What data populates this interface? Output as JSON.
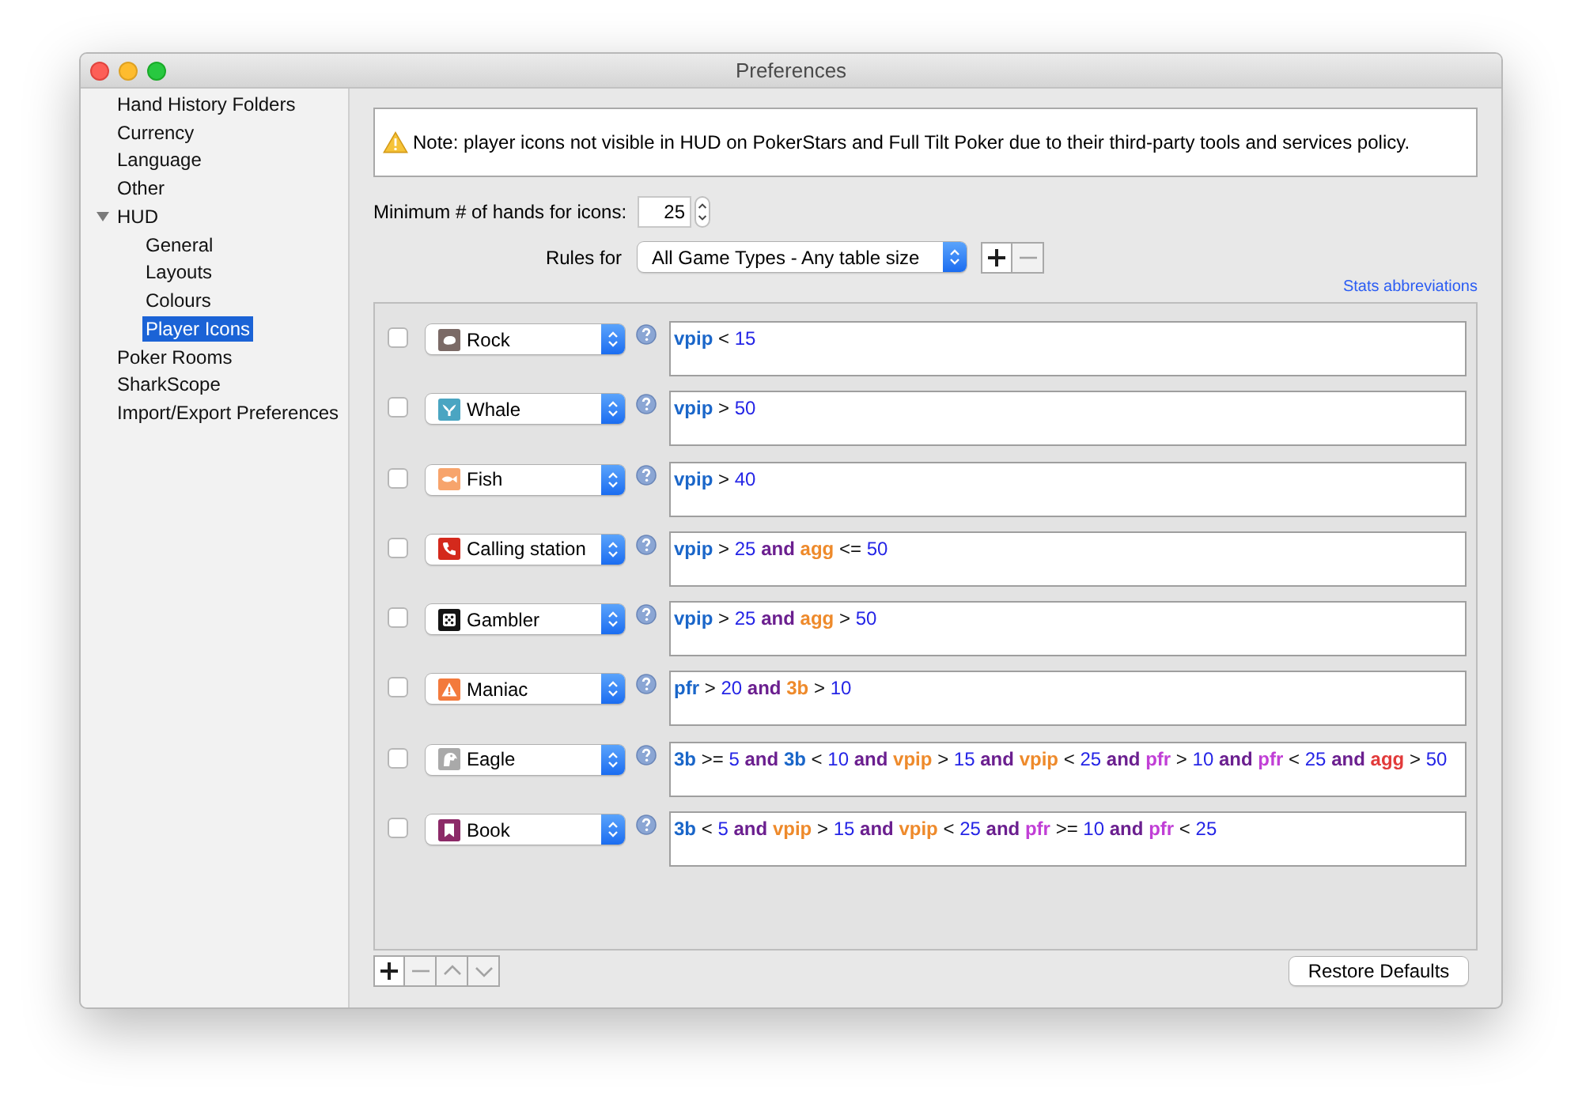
{
  "window": {
    "title": "Preferences"
  },
  "sidebar": {
    "items": [
      {
        "label": "Hand History Folders",
        "selected": false
      },
      {
        "label": "Currency",
        "selected": false
      },
      {
        "label": "Language",
        "selected": false
      },
      {
        "label": "Other",
        "selected": false
      },
      {
        "label": "HUD",
        "selected": false,
        "expanded": true,
        "children": [
          {
            "label": "General",
            "selected": false
          },
          {
            "label": "Layouts",
            "selected": false
          },
          {
            "label": "Colours",
            "selected": false
          },
          {
            "label": "Player Icons",
            "selected": true
          }
        ]
      },
      {
        "label": "Poker Rooms",
        "selected": false
      },
      {
        "label": "SharkScope",
        "selected": false
      },
      {
        "label": "Import/Export Preferences",
        "selected": false
      }
    ]
  },
  "note": {
    "text": "Note: player icons not visible in HUD on PokerStars and Full Tilt Poker due to their third-party tools and services policy."
  },
  "min_hands": {
    "label": "Minimum # of hands for icons:",
    "value": "25"
  },
  "rules_for": {
    "label": "Rules for",
    "value": "All Game Types - Any table size",
    "buttons": [
      {
        "kind": "add",
        "disabled": false
      },
      {
        "kind": "remove",
        "disabled": true
      }
    ]
  },
  "stats_link": "Stats abbreviations",
  "rules": [
    {
      "checked": false,
      "icon": {
        "kind": "rock",
        "color": "#7b6a66"
      },
      "type": "Rock",
      "condition": [
        {
          "kind": "stat",
          "text": "vpip",
          "color": "#1a66c9"
        },
        {
          "kind": "operator",
          "text": "<"
        },
        {
          "kind": "number",
          "text": "15"
        }
      ]
    },
    {
      "checked": false,
      "icon": {
        "kind": "whale",
        "color": "#4aa5c2"
      },
      "type": "Whale",
      "condition": [
        {
          "kind": "stat",
          "text": "vpip",
          "color": "#1a66c9"
        },
        {
          "kind": "operator",
          "text": ">"
        },
        {
          "kind": "number",
          "text": "50"
        }
      ]
    },
    {
      "checked": false,
      "icon": {
        "kind": "fish",
        "color": "#f7a46c"
      },
      "type": "Fish",
      "condition": [
        {
          "kind": "stat",
          "text": "vpip",
          "color": "#1a66c9"
        },
        {
          "kind": "operator",
          "text": ">"
        },
        {
          "kind": "number",
          "text": "40"
        }
      ]
    },
    {
      "checked": false,
      "icon": {
        "kind": "phone",
        "color": "#d4291c"
      },
      "type": "Calling station",
      "condition": [
        {
          "kind": "stat",
          "text": "vpip",
          "color": "#1a66c9"
        },
        {
          "kind": "operator",
          "text": ">"
        },
        {
          "kind": "number",
          "text": "25"
        },
        {
          "kind": "keyword",
          "text": "and"
        },
        {
          "kind": "stat",
          "text": "agg",
          "color": "#ee8a2b"
        },
        {
          "kind": "operator",
          "text": "<="
        },
        {
          "kind": "number",
          "text": "50"
        }
      ]
    },
    {
      "checked": false,
      "icon": {
        "kind": "dice",
        "color": "#151515"
      },
      "type": "Gambler",
      "condition": [
        {
          "kind": "stat",
          "text": "vpip",
          "color": "#1a66c9"
        },
        {
          "kind": "operator",
          "text": ">"
        },
        {
          "kind": "number",
          "text": "25"
        },
        {
          "kind": "keyword",
          "text": "and"
        },
        {
          "kind": "stat",
          "text": "agg",
          "color": "#ee8a2b"
        },
        {
          "kind": "operator",
          "text": ">"
        },
        {
          "kind": "number",
          "text": "50"
        }
      ]
    },
    {
      "checked": false,
      "icon": {
        "kind": "warning",
        "color": "#f37a3c"
      },
      "type": "Maniac",
      "condition": [
        {
          "kind": "stat",
          "text": "pfr",
          "color": "#1a66c9"
        },
        {
          "kind": "operator",
          "text": ">"
        },
        {
          "kind": "number",
          "text": "20"
        },
        {
          "kind": "keyword",
          "text": "and"
        },
        {
          "kind": "stat",
          "text": "3b",
          "color": "#ee8a2b"
        },
        {
          "kind": "operator",
          "text": ">"
        },
        {
          "kind": "number",
          "text": "10"
        }
      ]
    },
    {
      "checked": false,
      "icon": {
        "kind": "bird",
        "color": "#a9a9a9"
      },
      "type": "Eagle",
      "condition": [
        {
          "kind": "stat",
          "text": "3b",
          "color": "#1a66c9"
        },
        {
          "kind": "operator",
          "text": ">="
        },
        {
          "kind": "number",
          "text": "5"
        },
        {
          "kind": "keyword",
          "text": "and"
        },
        {
          "kind": "stat",
          "text": "3b",
          "color": "#1a66c9"
        },
        {
          "kind": "operator",
          "text": "<"
        },
        {
          "kind": "number",
          "text": "10"
        },
        {
          "kind": "keyword",
          "text": "and"
        },
        {
          "kind": "stat",
          "text": "vpip",
          "color": "#ee8a2b"
        },
        {
          "kind": "operator",
          "text": ">"
        },
        {
          "kind": "number",
          "text": "15"
        },
        {
          "kind": "keyword",
          "text": "and"
        },
        {
          "kind": "stat",
          "text": "vpip",
          "color": "#ee8a2b"
        },
        {
          "kind": "operator",
          "text": "<"
        },
        {
          "kind": "number",
          "text": "25"
        },
        {
          "kind": "keyword",
          "text": "and"
        },
        {
          "kind": "stat",
          "text": "pfr",
          "color": "#c13fd6"
        },
        {
          "kind": "operator",
          "text": ">"
        },
        {
          "kind": "number",
          "text": "10"
        },
        {
          "kind": "keyword",
          "text": "and"
        },
        {
          "kind": "stat",
          "text": "pfr",
          "color": "#c13fd6"
        },
        {
          "kind": "operator",
          "text": "<"
        },
        {
          "kind": "number",
          "text": "25"
        },
        {
          "kind": "keyword",
          "text": "and"
        },
        {
          "kind": "stat",
          "text": "agg",
          "color": "#e23a3a"
        },
        {
          "kind": "operator",
          "text": ">"
        },
        {
          "kind": "number",
          "text": "50"
        }
      ]
    },
    {
      "checked": false,
      "icon": {
        "kind": "bookmark",
        "color": "#8c2a68"
      },
      "type": "Book",
      "condition": [
        {
          "kind": "stat",
          "text": "3b",
          "color": "#1a66c9"
        },
        {
          "kind": "operator",
          "text": "<"
        },
        {
          "kind": "number",
          "text": "5"
        },
        {
          "kind": "keyword",
          "text": "and"
        },
        {
          "kind": "stat",
          "text": "vpip",
          "color": "#ee8a2b"
        },
        {
          "kind": "operator",
          "text": ">"
        },
        {
          "kind": "number",
          "text": "15"
        },
        {
          "kind": "keyword",
          "text": "and"
        },
        {
          "kind": "stat",
          "text": "vpip",
          "color": "#ee8a2b"
        },
        {
          "kind": "operator",
          "text": "<"
        },
        {
          "kind": "number",
          "text": "25"
        },
        {
          "kind": "keyword",
          "text": "and"
        },
        {
          "kind": "stat",
          "text": "pfr",
          "color": "#c13fd6"
        },
        {
          "kind": "operator",
          "text": ">="
        },
        {
          "kind": "number",
          "text": "10"
        },
        {
          "kind": "keyword",
          "text": "and"
        },
        {
          "kind": "stat",
          "text": "pfr",
          "color": "#c13fd6"
        },
        {
          "kind": "operator",
          "text": "<"
        },
        {
          "kind": "number",
          "text": "25"
        }
      ]
    }
  ],
  "list_toolbar": {
    "buttons": [
      {
        "kind": "add",
        "disabled": false
      },
      {
        "kind": "remove",
        "disabled": true
      },
      {
        "kind": "up",
        "disabled": true
      },
      {
        "kind": "down",
        "disabled": true
      }
    ]
  },
  "restore_button": "Restore Defaults"
}
